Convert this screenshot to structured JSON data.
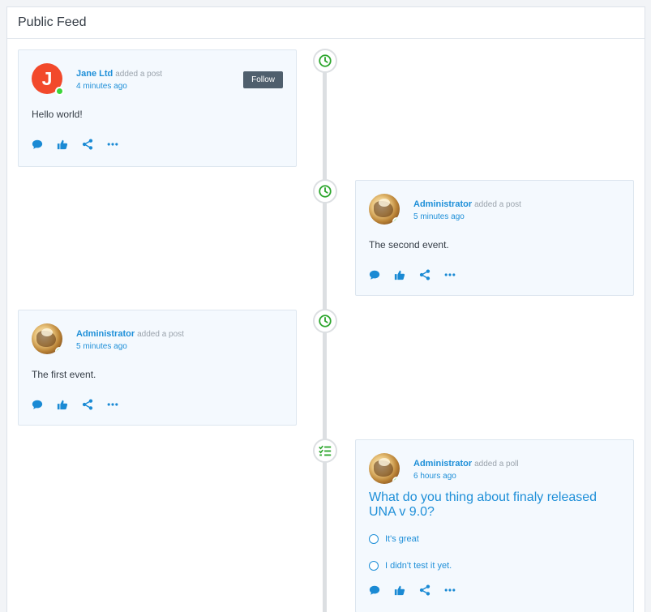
{
  "feed": {
    "title": "Public Feed"
  },
  "colors": {
    "accent": "#1e8fd8",
    "marker_icon": "#2ba52b",
    "online": "#3ad63a",
    "card_bg": "#f4f9fe",
    "follow_button": "#4f5f6d"
  },
  "posts": [
    {
      "author": "Jane Ltd",
      "action": "added a post",
      "time": "4 minutes ago",
      "avatar_letter": "J",
      "follow_label": "Follow",
      "text": "Hello world!",
      "marker_icon": "clock-icon"
    },
    {
      "author": "Administrator",
      "action": "added a post",
      "time": "5 minutes ago",
      "text": "The second event.",
      "marker_icon": "clock-icon"
    },
    {
      "author": "Administrator",
      "action": "added a post",
      "time": "5 minutes ago",
      "text": "The first event.",
      "marker_icon": "clock-icon"
    },
    {
      "author": "Administrator",
      "action": "added a poll",
      "time": "6 hours ago",
      "question": "What do you thing about finaly released UNA v 9.0?",
      "options": [
        "It's great",
        "I didn't test it yet."
      ],
      "marker_icon": "poll-list-icon"
    }
  ],
  "action_icons": [
    "comment-icon",
    "thumbs-up-icon",
    "share-icon",
    "more-icon"
  ]
}
